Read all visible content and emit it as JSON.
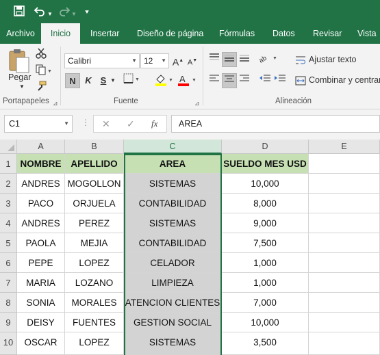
{
  "ribbon_tabs": [
    "Archivo",
    "Inicio",
    "Insertar",
    "Diseño de página",
    "Fórmulas",
    "Datos",
    "Revisar",
    "Vista"
  ],
  "active_tab": "Inicio",
  "clipboard": {
    "paste_label": "Pegar",
    "group_label": "Portapapeles"
  },
  "font": {
    "name": "Calibri",
    "size": "12",
    "group_label": "Fuente",
    "bold": "N",
    "italic": "K",
    "underline": "S",
    "fill_color": "#ffff00",
    "font_color": "#ff0000"
  },
  "alignment": {
    "wrap_text": "Ajustar texto",
    "merge_center": "Combinar y centrar",
    "group_label": "Alineación"
  },
  "formula_bar": {
    "name_box": "C1",
    "fx": "fx",
    "content": "AREA"
  },
  "columns": [
    "A",
    "B",
    "C",
    "D",
    "E"
  ],
  "selected_column": "C",
  "rows": [
    "1",
    "2",
    "3",
    "4",
    "5",
    "6",
    "7",
    "8",
    "9",
    "10"
  ],
  "table": {
    "headers": [
      "NOMBRE",
      "APELLIDO",
      "AREA",
      "SUELDO MES USD"
    ],
    "data": [
      [
        "ANDRES",
        "MOGOLLON",
        "SISTEMAS",
        "10,000"
      ],
      [
        "PACO",
        "ORJUELA",
        "CONTABILIDAD",
        "8,000"
      ],
      [
        "ANDRES",
        "PEREZ",
        "SISTEMAS",
        "9,000"
      ],
      [
        "PAOLA",
        "MEJIA",
        "CONTABILIDAD",
        "7,500"
      ],
      [
        "PEPE",
        "LOPEZ",
        "CELADOR",
        "1,000"
      ],
      [
        "MARIA",
        "LOZANO",
        "LIMPIEZA",
        "1,000"
      ],
      [
        "SONIA",
        "MORALES",
        "ATENCION CLIENTES",
        "7,000"
      ],
      [
        "DEISY",
        "FUENTES",
        "GESTION SOCIAL",
        "10,000"
      ],
      [
        "OSCAR",
        "LOPEZ",
        "SISTEMAS",
        "3,500"
      ]
    ]
  },
  "colors": {
    "excel_green": "#217346",
    "header_fill": "#c6e0b4",
    "selected_fill": "#d3d3d3"
  }
}
